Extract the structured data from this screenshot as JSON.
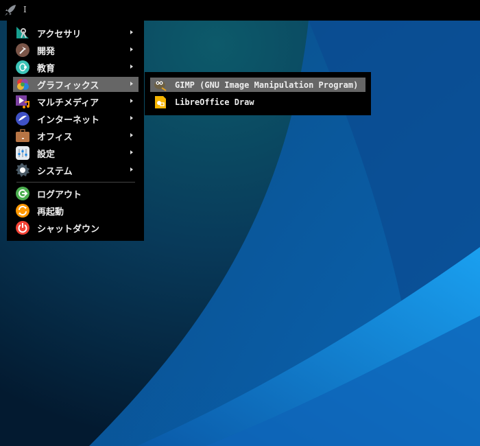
{
  "menu": {
    "items": [
      {
        "label": "アクセサリ",
        "icon": "accessories-icon",
        "submenu": true
      },
      {
        "label": "開発",
        "icon": "development-icon",
        "submenu": true
      },
      {
        "label": "教育",
        "icon": "education-icon",
        "submenu": true
      },
      {
        "label": "グラフィックス",
        "icon": "graphics-icon",
        "submenu": true,
        "selected": true
      },
      {
        "label": "マルチメディア",
        "icon": "multimedia-icon",
        "submenu": true
      },
      {
        "label": "インターネット",
        "icon": "internet-icon",
        "submenu": true
      },
      {
        "label": "オフィス",
        "icon": "office-icon",
        "submenu": true
      },
      {
        "label": "設定",
        "icon": "settings-icon",
        "submenu": true
      },
      {
        "label": "システム",
        "icon": "system-icon",
        "submenu": true
      }
    ],
    "actions": [
      {
        "label": "ログアウト",
        "icon": "logout-icon",
        "color": "#4caf50"
      },
      {
        "label": "再起動",
        "icon": "reboot-icon",
        "color": "#ff9800"
      },
      {
        "label": "シャットダウン",
        "icon": "shutdown-icon",
        "color": "#f44336"
      }
    ]
  },
  "submenu": {
    "items": [
      {
        "label": "GIMP (GNU Image Manipulation Program)",
        "icon": "gimp-icon",
        "selected": true
      },
      {
        "label": "LibreOffice Draw",
        "icon": "libreoffice-draw-icon"
      }
    ]
  },
  "topbar": {
    "cursor": "I"
  }
}
